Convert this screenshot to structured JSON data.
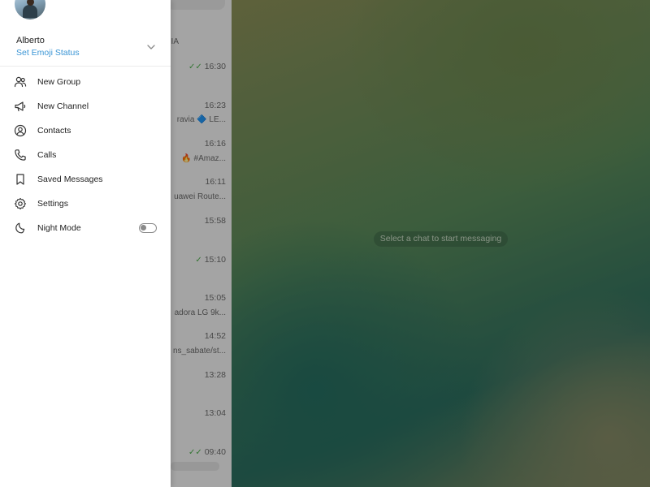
{
  "user": {
    "name": "Alberto",
    "emoji_status": "Set Emoji Status"
  },
  "menu": {
    "items": [
      {
        "label": "New Group",
        "icon": "group-icon"
      },
      {
        "label": "New Channel",
        "icon": "megaphone-icon"
      },
      {
        "label": "Contacts",
        "icon": "contact-icon"
      },
      {
        "label": "Calls",
        "icon": "phone-icon"
      },
      {
        "label": "Saved Messages",
        "icon": "bookmark-icon"
      },
      {
        "label": "Settings",
        "icon": "gear-icon"
      },
      {
        "label": "Night Mode",
        "icon": "moon-icon",
        "toggle": false
      }
    ]
  },
  "chat_area": {
    "placeholder": "Select a chat to start messaging"
  },
  "chat_list": {
    "rows": [
      {
        "time": "",
        "snippet": "IA",
        "read": false
      },
      {
        "time": "16:30",
        "snippet": "",
        "read": true
      },
      {
        "time": "16:23",
        "snippet": "ravia  🔷 LE...",
        "read": false
      },
      {
        "time": "16:16",
        "snippet": "🔥 #Amaz...",
        "read": false
      },
      {
        "time": "16:11",
        "snippet": "uawei Route...",
        "read": false
      },
      {
        "time": "15:58",
        "snippet": "",
        "read": false
      },
      {
        "time": "15:10",
        "snippet": "",
        "read": true
      },
      {
        "time": "15:05",
        "snippet": "adora LG 9k...",
        "read": false
      },
      {
        "time": "14:52",
        "snippet": "ns_sabate/st...",
        "read": false
      },
      {
        "time": "13:28",
        "snippet": "",
        "read": false
      },
      {
        "time": "13:04",
        "snippet": "",
        "read": false
      },
      {
        "time": "09:40",
        "snippet": "",
        "read": true
      }
    ]
  },
  "colors": {
    "accent": "#3a95d5",
    "read_check": "#4fae4e"
  }
}
